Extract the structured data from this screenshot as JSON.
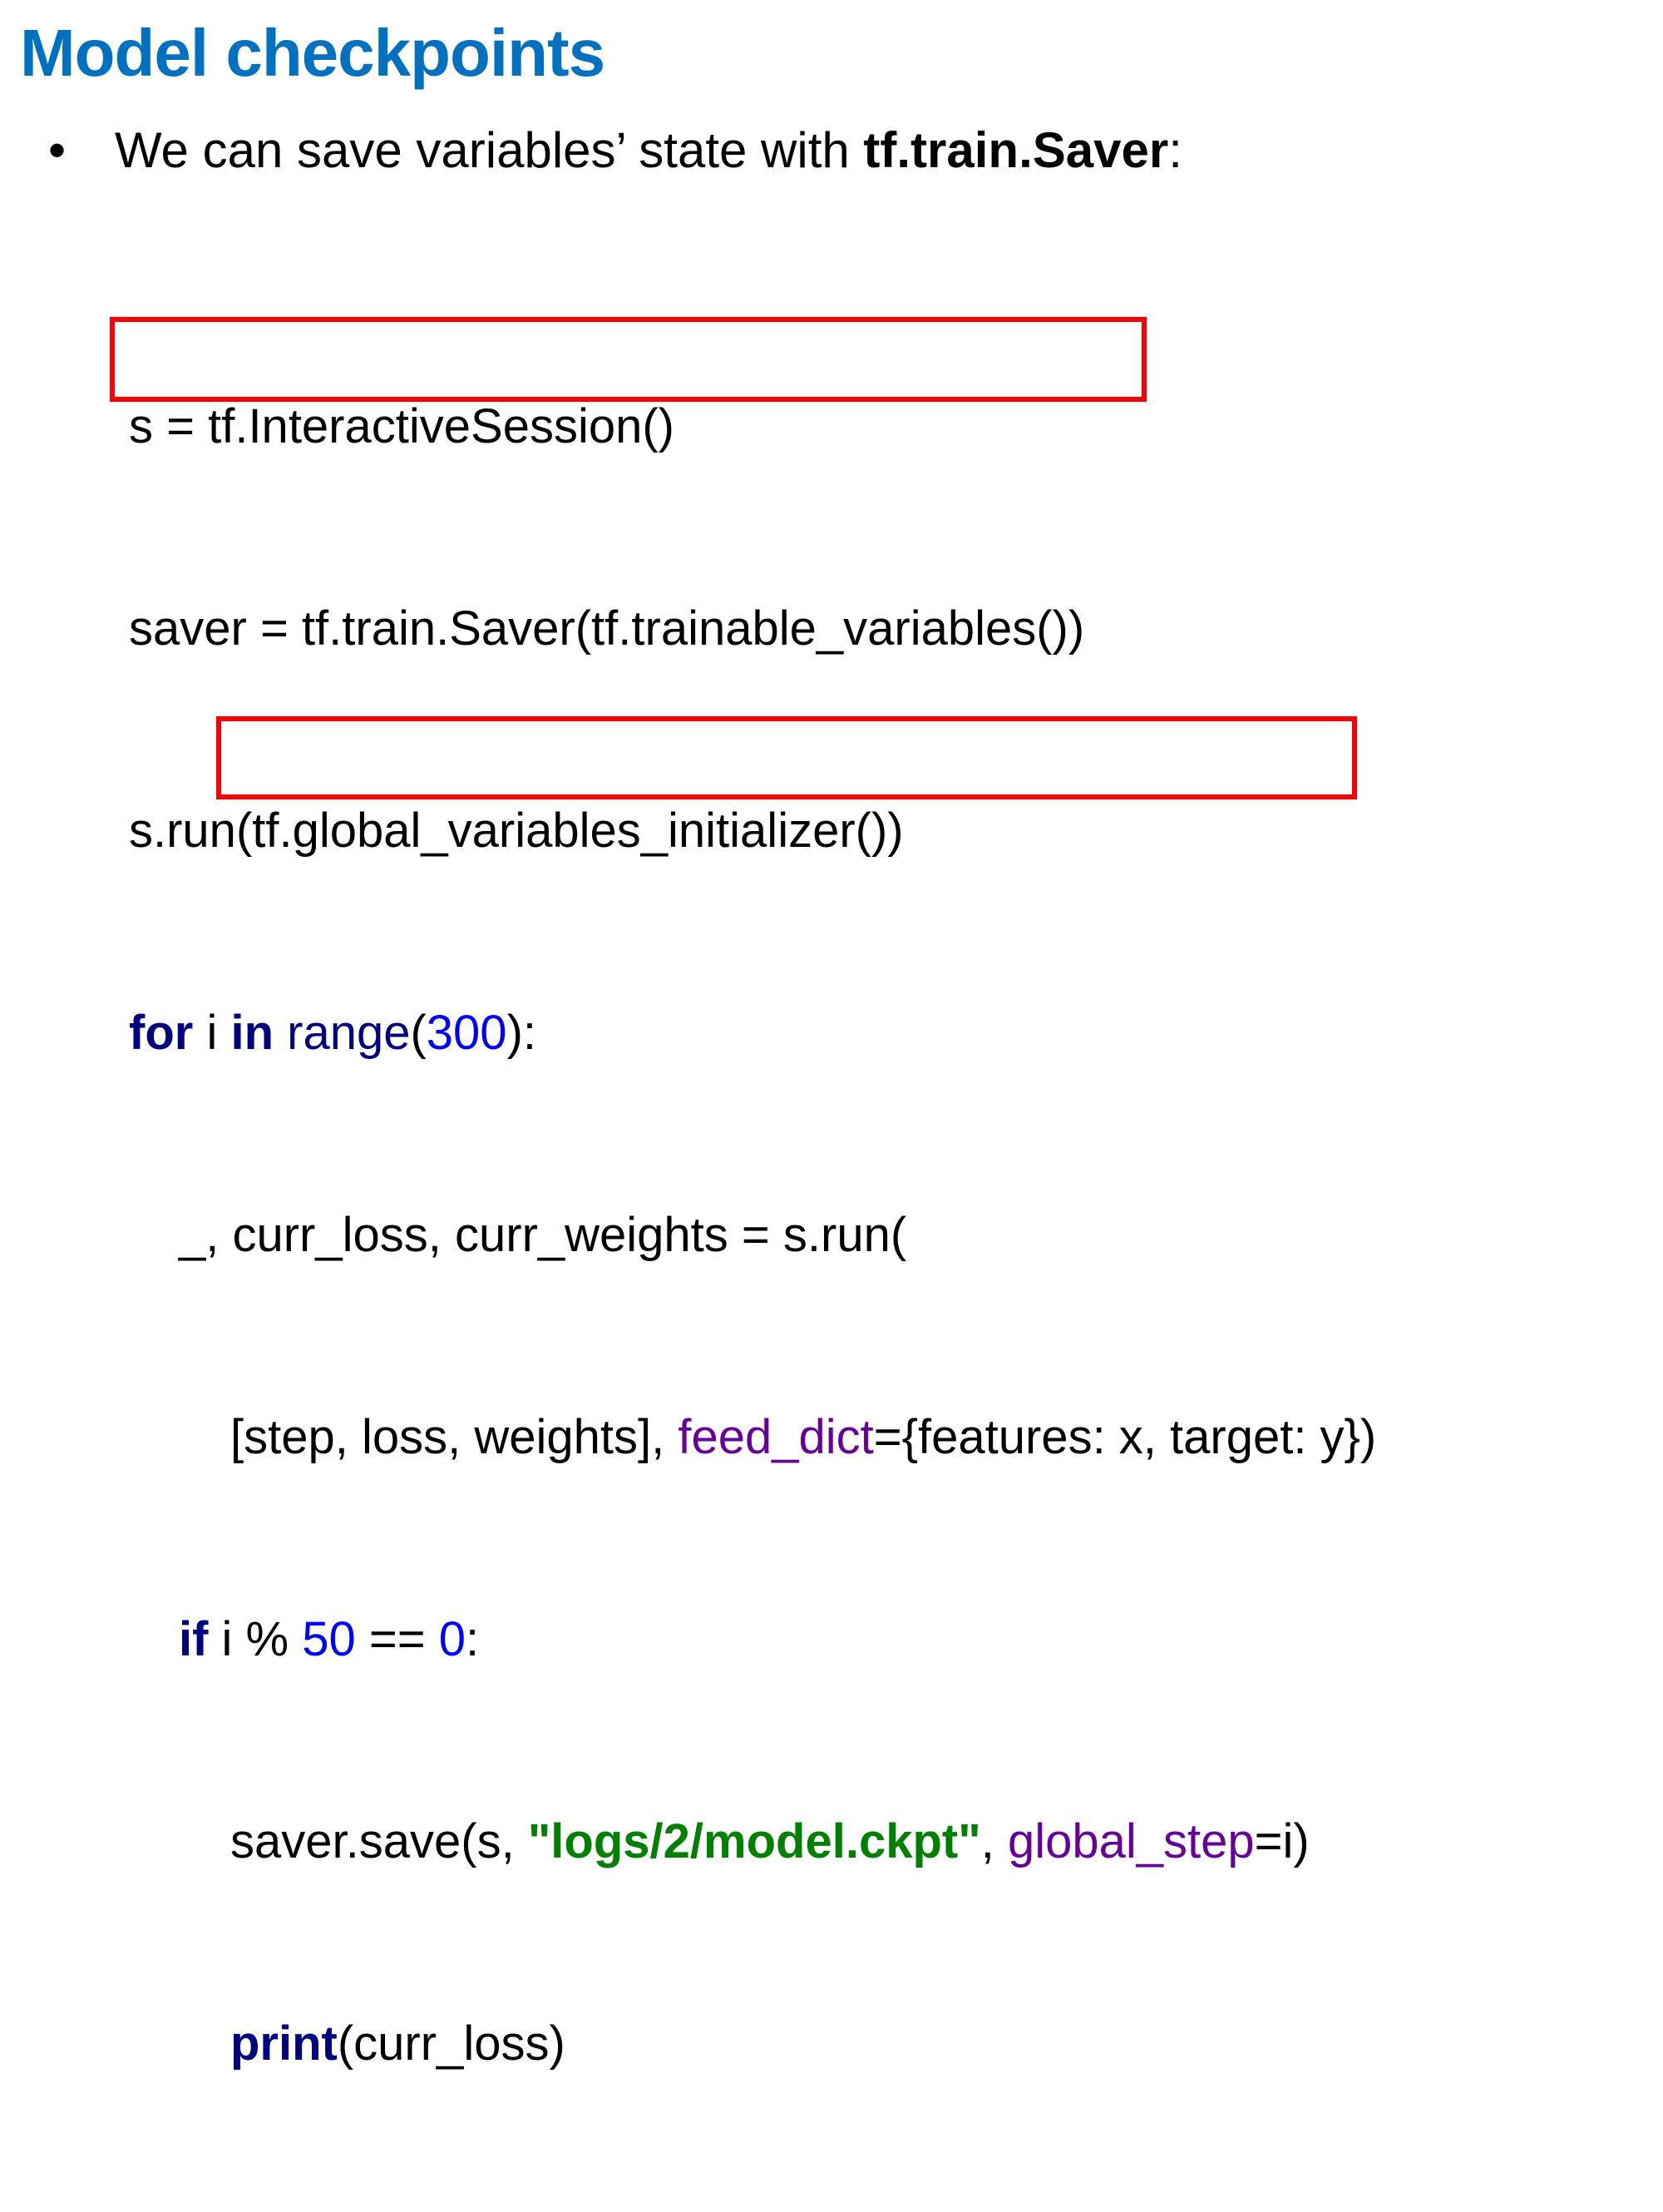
{
  "title": "Model checkpoints",
  "bullet": {
    "marker": "•",
    "text_before": "We can save variables’ state with ",
    "text_bold": "tf.train.Saver",
    "text_after": ":"
  },
  "code": {
    "line1": "s = tf.InteractiveSession()",
    "line2": "saver = tf.train.Saver(tf.trainable_variables())",
    "line3": "s.run(tf.global_variables_initializer())",
    "line4": {
      "kw_for": "for",
      "sp_i": " i ",
      "kw_in": "in",
      "sp": " ",
      "range": "range",
      "open": "(",
      "num": "300",
      "close": "):"
    },
    "line5": "_, curr_loss, curr_weights = s.run(",
    "line6": {
      "pre": "[step, loss, weights], ",
      "kwarg": "feed_dict",
      "post": "={features: x, target: y})"
    },
    "line7": {
      "kw_if": "if",
      "mid": " i % ",
      "num50": "50",
      "eq": " == ",
      "num0": "0",
      "colon": ":"
    },
    "line8": {
      "pre": "saver.save(s, ",
      "str": "\"logs/2/model.ckpt\"",
      "comma": ", ",
      "kwarg": "global_step",
      "post": "=i)"
    },
    "line9": {
      "print": "print",
      "args": "(curr_loss)"
    }
  },
  "colors": {
    "title": "#0070c0",
    "keyword": "#000080",
    "number": "#0000ff",
    "named_arg": "#660099",
    "string": "#008000",
    "highlight_box": "#ff0000"
  }
}
